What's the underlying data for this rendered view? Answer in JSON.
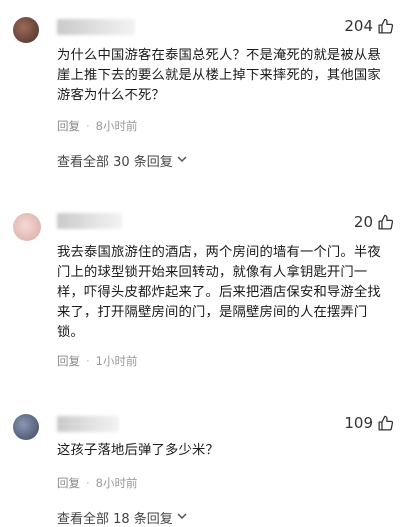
{
  "comments": [
    {
      "likes": "204",
      "text": "为什么中国游客在泰国总死人？不是淹死的就是被从悬崖上推下去的要么就是从楼上掉下来摔死的，其他国家游客为什么不死？",
      "reply_label": "回复",
      "sep": "·",
      "time": "8小时前",
      "view_replies": "查看全部 30 条回复",
      "avatar_color": "#6b4a3f"
    },
    {
      "likes": "20",
      "text": "我去泰国旅游住的酒店，两个房间的墙有一个门。半夜门上的球型锁开始来回转动，就像有人拿钥匙开门一样，吓得头皮都炸起来了。后来把酒店保安和导游全找来了，打开隔壁房间的门，是隔壁房间的人在摆弄门锁。",
      "reply_label": "回复",
      "sep": "·",
      "time": "1小时前",
      "avatar_color": "#e8c4c0"
    },
    {
      "likes": "109",
      "text": "这孩子落地后弹了多少米？",
      "reply_label": "回复",
      "sep": "·",
      "time": "8小时前",
      "view_replies": "查看全部 18 条回复",
      "avatar_color": "#4d5a73"
    }
  ]
}
